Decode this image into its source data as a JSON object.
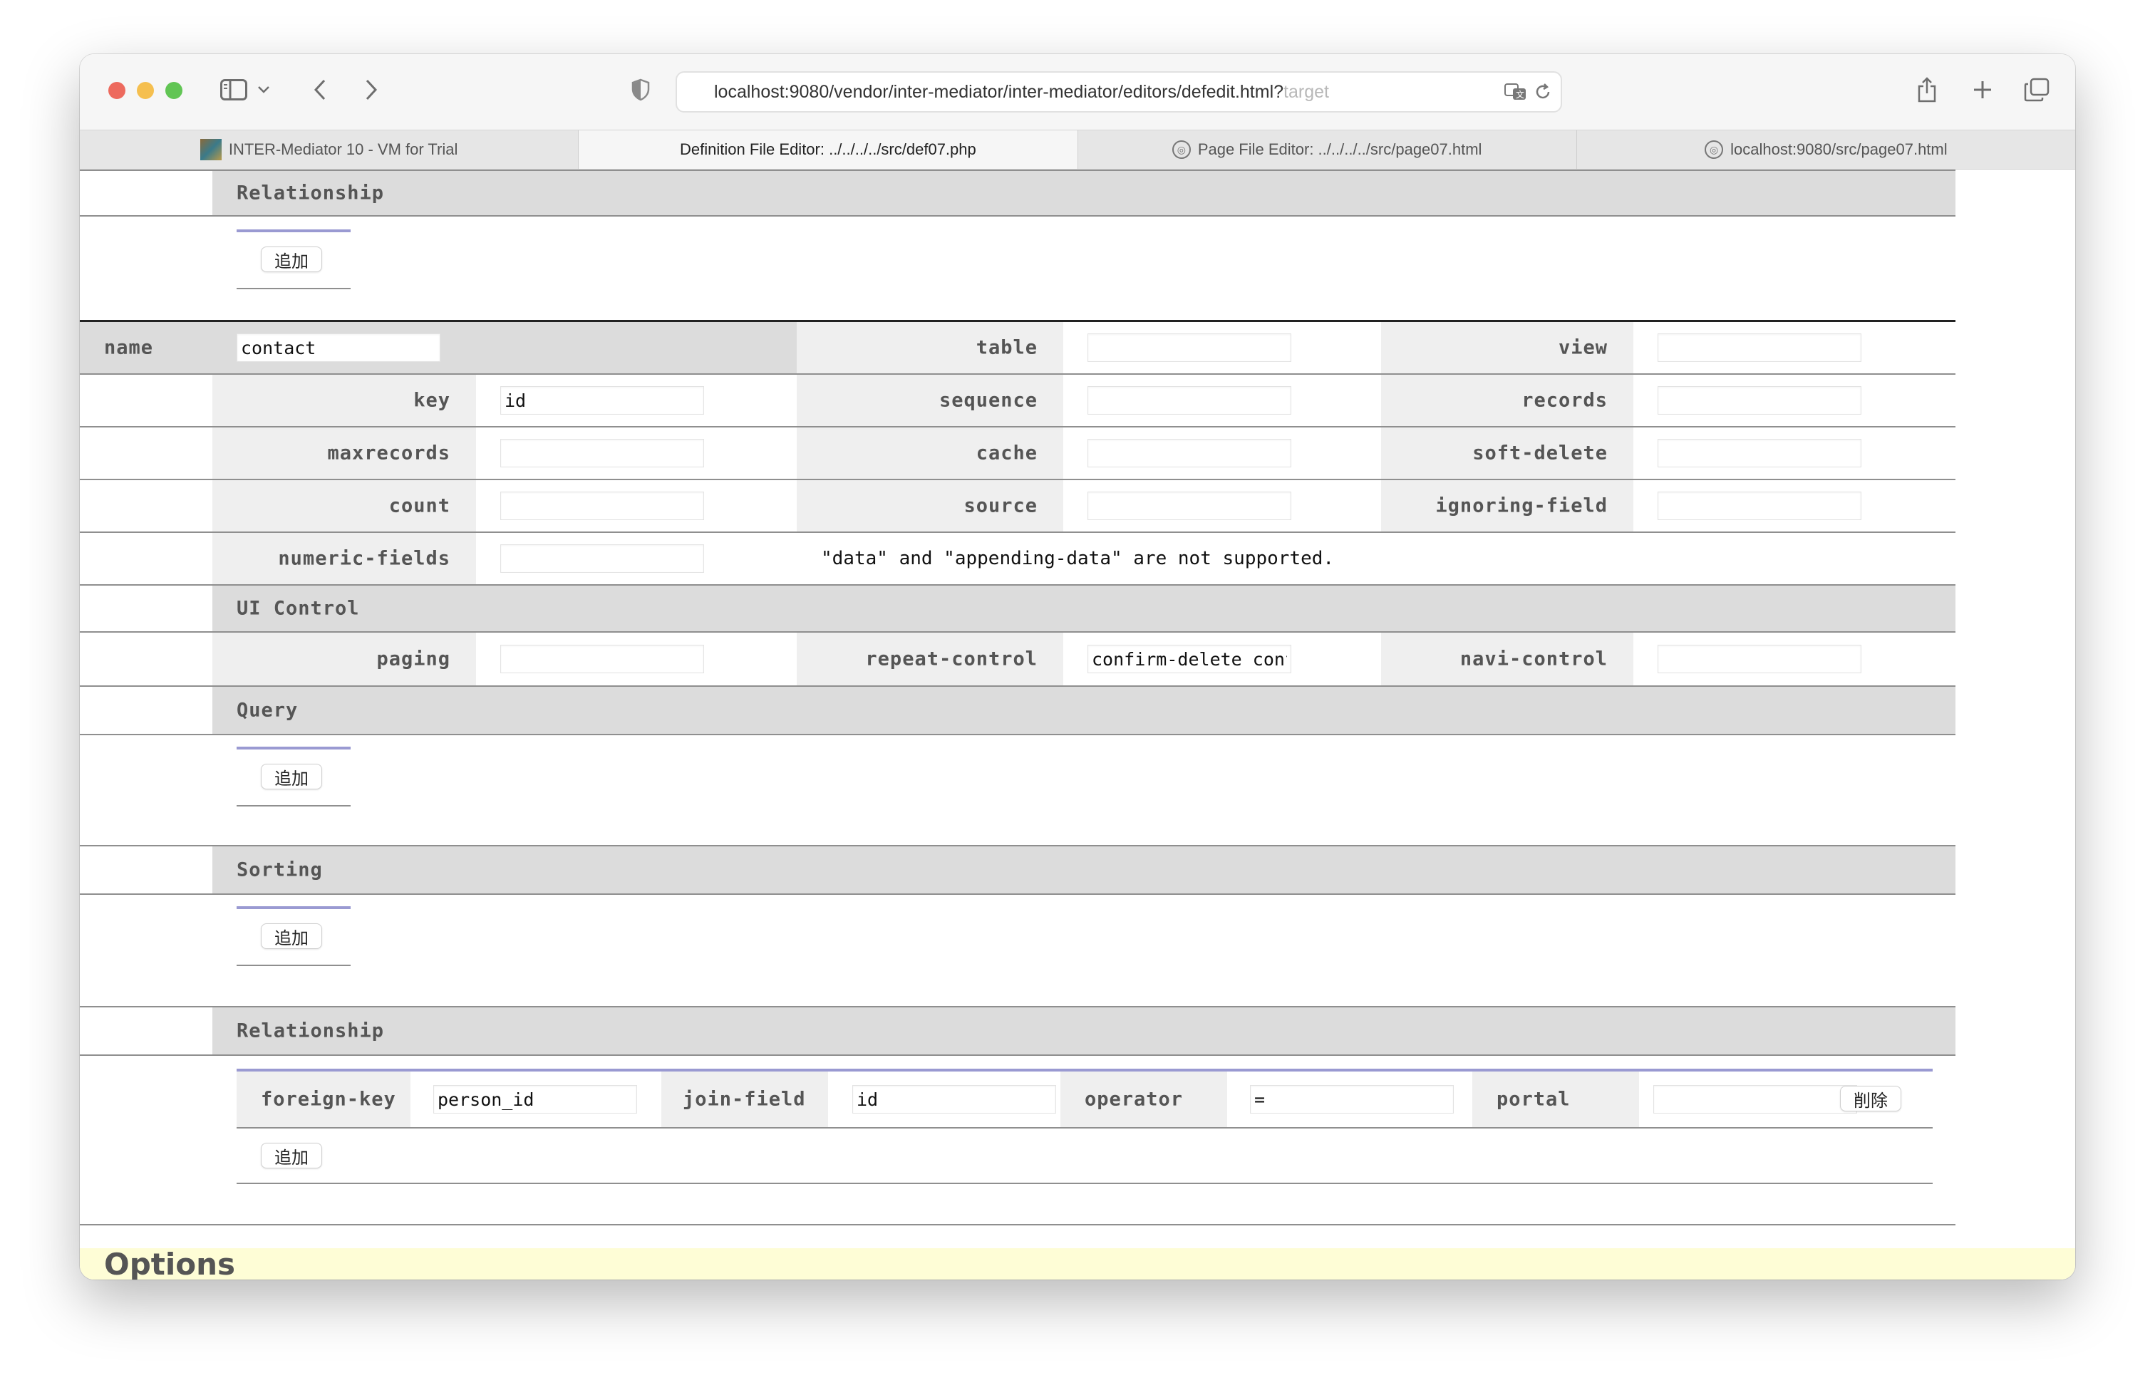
{
  "browser": {
    "url_prefix": "localhost:9080/vendor/inter-mediator/inter-mediator/editors/defedit.html?",
    "url_suffix": "target",
    "tabs": [
      {
        "label": "INTER-Mediator 10 - VM for Trial",
        "icon": "app-favicon"
      },
      {
        "label": "Definition File Editor: ../../../../src/def07.php",
        "icon": "none"
      },
      {
        "label": "Page File Editor: ../../../../src/page07.html",
        "icon": "compass-icon"
      },
      {
        "label": "localhost:9080/src/page07.html",
        "icon": "compass-icon"
      }
    ]
  },
  "top_relationship": {
    "title": "Relationship",
    "add_label": "追加"
  },
  "context": {
    "fields": {
      "name": {
        "label": "name",
        "value": "contact"
      },
      "table": {
        "label": "table",
        "value": ""
      },
      "view": {
        "label": "view",
        "value": ""
      },
      "key": {
        "label": "key",
        "value": "id"
      },
      "sequence": {
        "label": "sequence",
        "value": ""
      },
      "records": {
        "label": "records",
        "value": ""
      },
      "maxrecords": {
        "label": "maxrecords",
        "value": ""
      },
      "cache": {
        "label": "cache",
        "value": ""
      },
      "soft_delete": {
        "label": "soft-delete",
        "value": ""
      },
      "count": {
        "label": "count",
        "value": ""
      },
      "source": {
        "label": "source",
        "value": ""
      },
      "ignoring_field": {
        "label": "ignoring-field",
        "value": ""
      },
      "numeric_fields": {
        "label": "numeric-fields",
        "value": ""
      }
    },
    "note": "\"data\" and \"appending-data\" are not supported."
  },
  "ui_control": {
    "title": "UI Control",
    "paging": {
      "label": "paging",
      "value": ""
    },
    "repeat_control": {
      "label": "repeat-control",
      "value": "confirm-delete confirm-insert"
    },
    "navi_control": {
      "label": "navi-control",
      "value": ""
    }
  },
  "query": {
    "title": "Query",
    "add_label": "追加"
  },
  "sorting": {
    "title": "Sorting",
    "add_label": "追加"
  },
  "relationship": {
    "title": "Relationship",
    "add_label": "追加",
    "delete_label": "削除",
    "foreign_key": {
      "label": "foreign-key",
      "value": "person_id"
    },
    "join_field": {
      "label": "join-field",
      "value": "id"
    },
    "operator": {
      "label": "operator",
      "value": "="
    },
    "portal": {
      "label": "portal",
      "value": ""
    }
  },
  "options": {
    "title": "Options"
  },
  "colors": {
    "accent": "#9a9ad2",
    "options_bg": "#fefdd6",
    "header_bg": "#dcdcdc"
  }
}
